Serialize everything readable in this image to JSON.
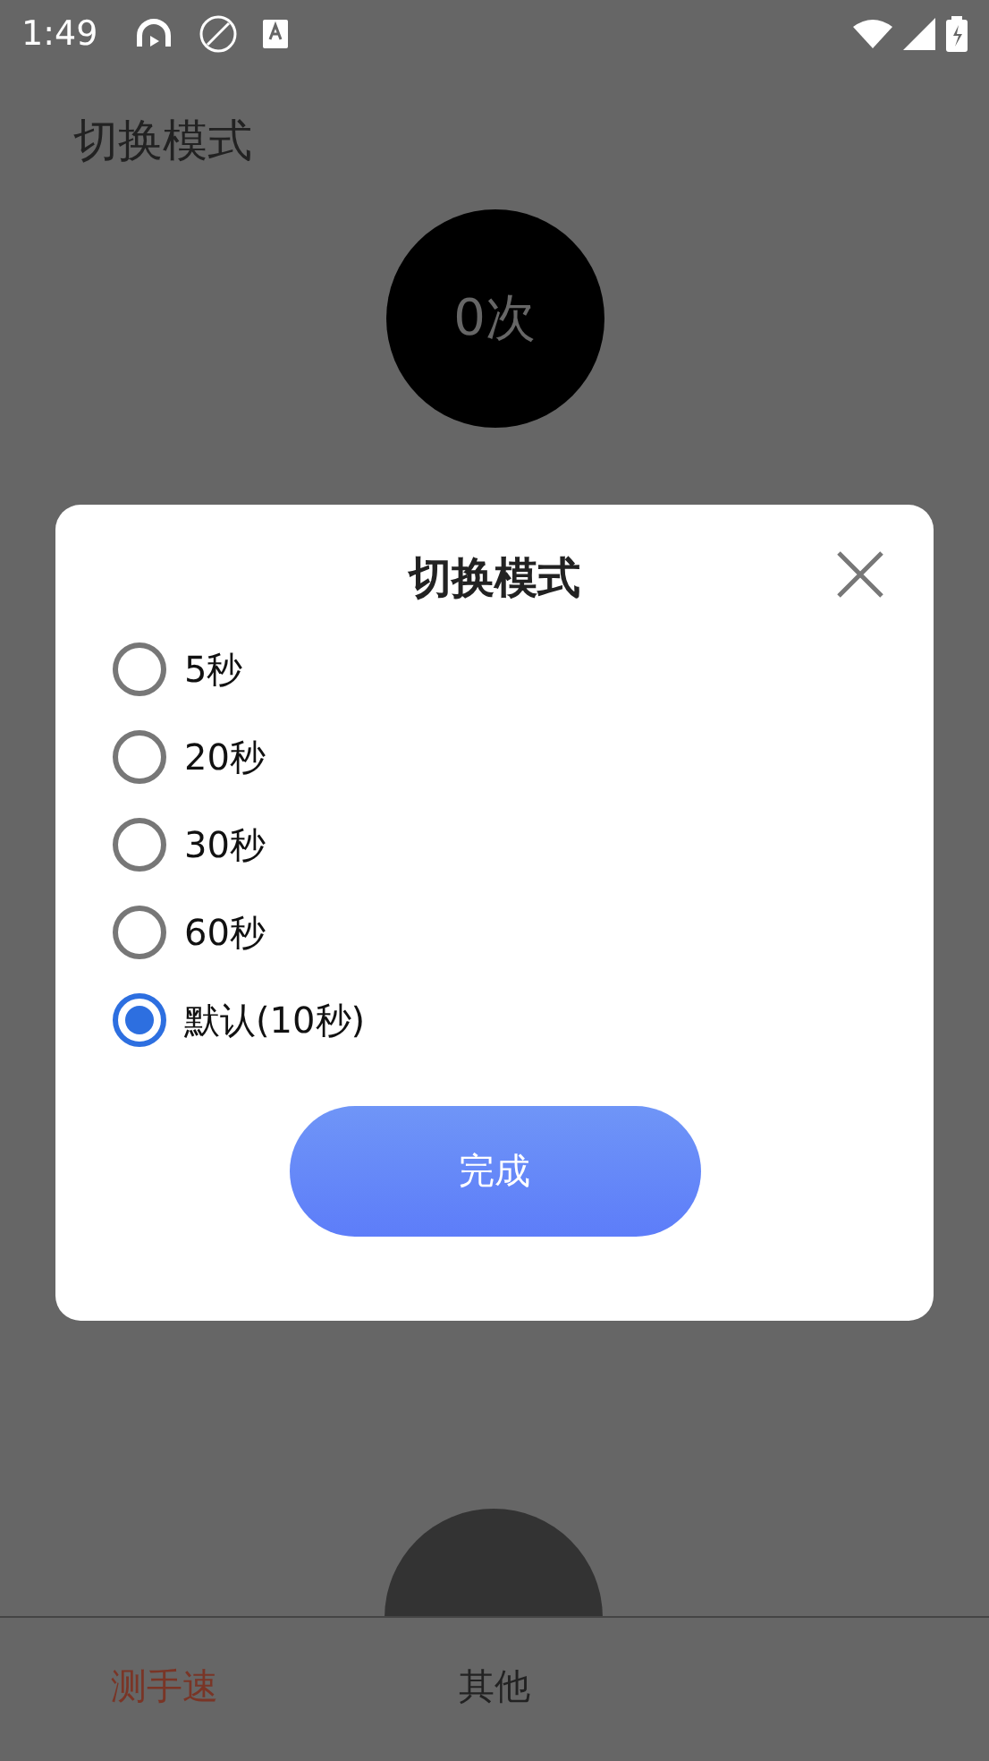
{
  "status_bar": {
    "time": "1:49"
  },
  "page": {
    "title": "切换模式",
    "counter": "0次"
  },
  "dialog": {
    "title": "切换模式",
    "options": [
      {
        "label": "5秒",
        "selected": false
      },
      {
        "label": "20秒",
        "selected": false
      },
      {
        "label": "30秒",
        "selected": false
      },
      {
        "label": "60秒",
        "selected": false
      },
      {
        "label": "默认(10秒)",
        "selected": true
      }
    ],
    "confirm_button": "完成"
  },
  "bottom_nav": [
    {
      "label": "测手速",
      "selected": true
    },
    {
      "label": "其他",
      "selected": false
    }
  ]
}
